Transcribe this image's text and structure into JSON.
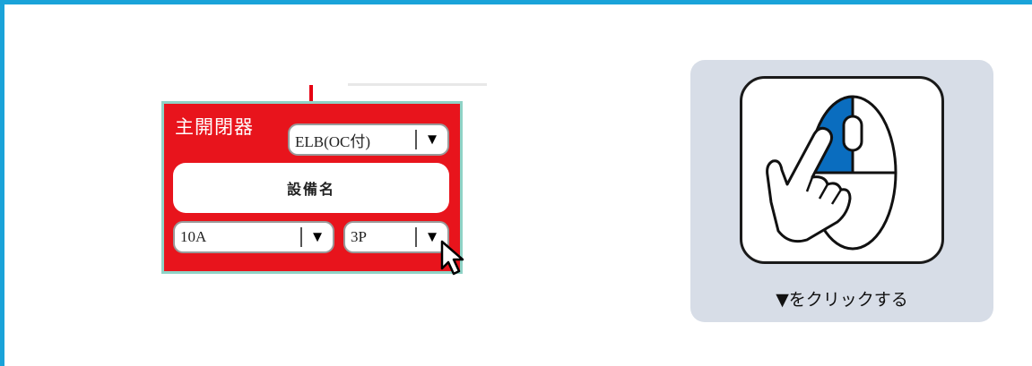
{
  "panel": {
    "title": "主開閉器",
    "breaker_type": {
      "value": "ELB(OC付)",
      "arrow": "▼"
    },
    "equipment_name": "設備名",
    "ampere": {
      "value": "10A",
      "arrow": "▼"
    },
    "poles": {
      "value": "3P",
      "arrow": "▼"
    }
  },
  "hint": {
    "text": "▼をクリックする",
    "icon": "mouse-left-click-icon"
  },
  "colors": {
    "frame": "#1aa3d9",
    "panel_bg": "#e8141c",
    "panel_border": "#8fd3c6",
    "hint_bg": "#d7dde7",
    "mouse_button_highlight": "#0a6dbf"
  }
}
